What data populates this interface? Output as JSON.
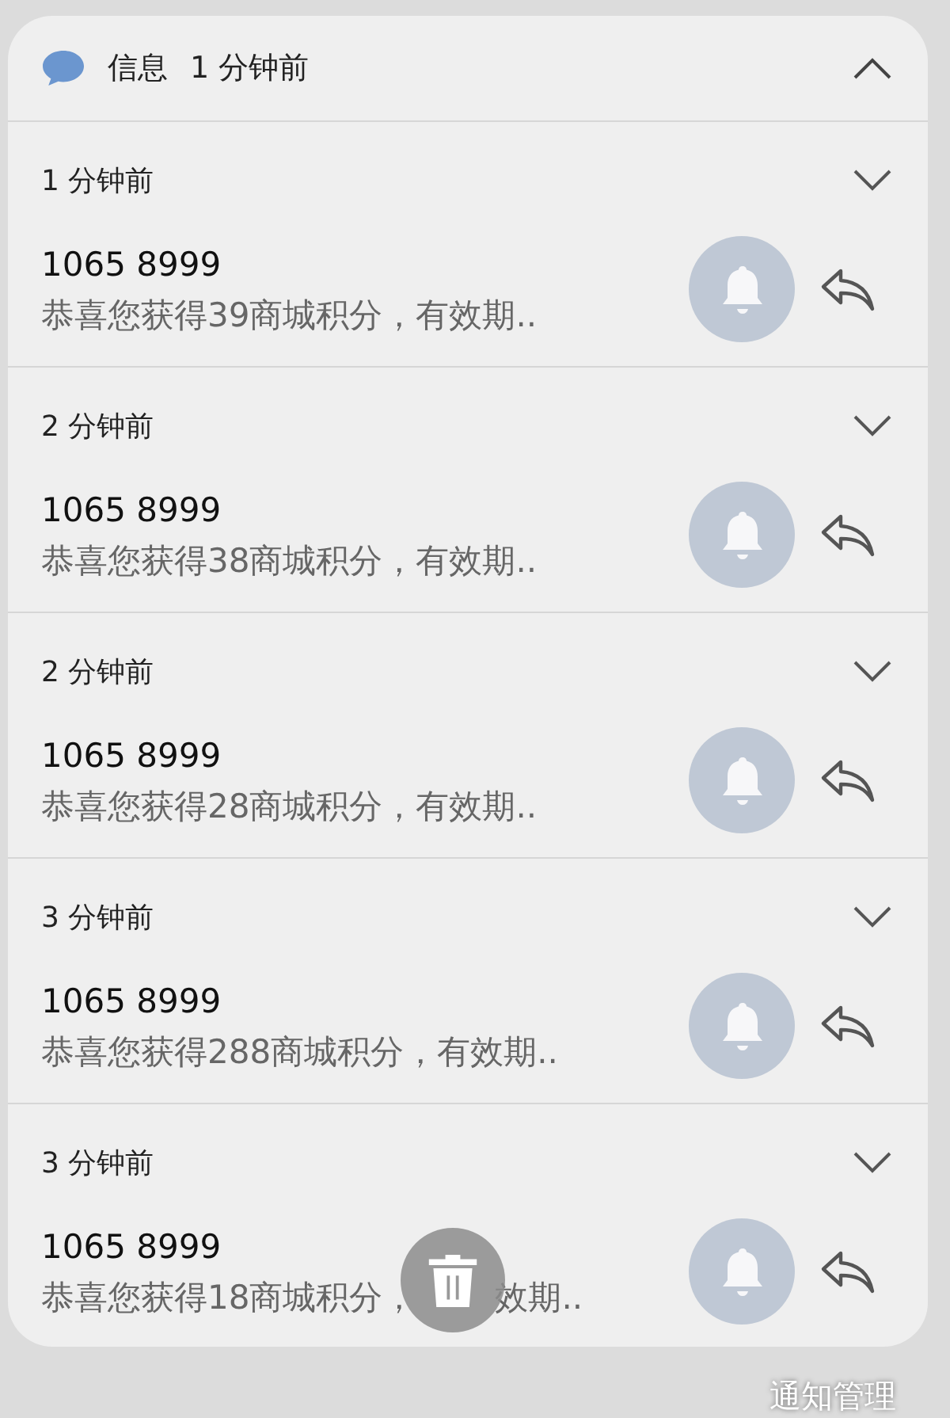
{
  "group": {
    "app": "信息",
    "time": "1 分钟前",
    "expanded": true
  },
  "notifications": [
    {
      "time": "1 分钟前",
      "sender": "1065 8999",
      "message": "恭喜您获得39商城积分，有效期..",
      "expanded": false
    },
    {
      "time": "2 分钟前",
      "sender": "1065 8999",
      "message": "恭喜您获得38商城积分，有效期..",
      "expanded": false
    },
    {
      "time": "2 分钟前",
      "sender": "1065 8999",
      "message": "恭喜您获得28商城积分，有效期..",
      "expanded": false
    },
    {
      "time": "3 分钟前",
      "sender": "1065 8999",
      "message": "恭喜您获得288商城积分，有效期..",
      "expanded": false
    },
    {
      "time": "3 分钟前",
      "sender": "1065 8999",
      "message": "恭喜您获得18商城积分，",
      "message_tail": "效期..",
      "expanded": false
    }
  ],
  "footer_link": "通知管理"
}
